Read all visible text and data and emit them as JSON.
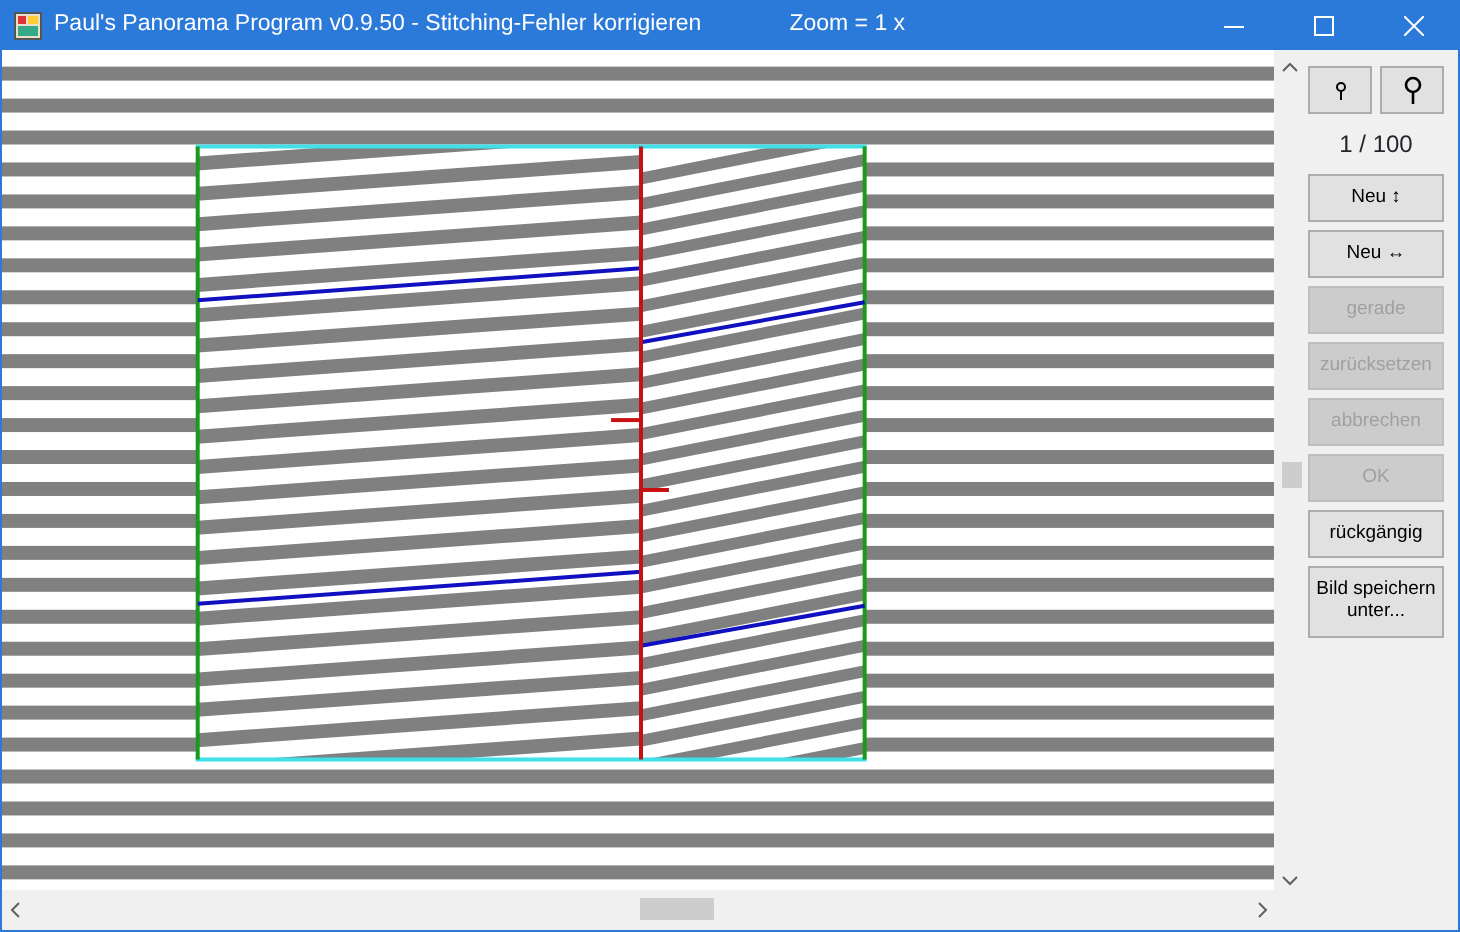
{
  "window": {
    "title": "Paul's Panorama Program v0.9.50 - Stitching-Fehler korrigieren",
    "zoom": "Zoom = 1 x"
  },
  "counter": "1 / 100",
  "buttons": [
    {
      "label": "Neu ↕",
      "disabled": false
    },
    {
      "label": "Neu ↔",
      "disabled": false
    },
    {
      "label": "gerade",
      "disabled": true
    },
    {
      "label": "zurücksetzen",
      "disabled": true
    },
    {
      "label": "abbrechen",
      "disabled": true
    },
    {
      "label": "OK",
      "disabled": true
    },
    {
      "label": "rückgängig",
      "disabled": false
    },
    {
      "label": "Bild speichern unter...",
      "disabled": false
    }
  ]
}
